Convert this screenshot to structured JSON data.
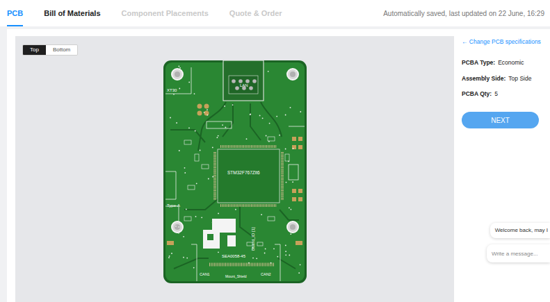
{
  "nav": {
    "tabs": [
      {
        "label": "PCB",
        "selected": true,
        "disabled": false
      },
      {
        "label": "Bill of Materials",
        "selected": false,
        "disabled": false
      },
      {
        "label": "Component Placements",
        "selected": false,
        "disabled": true
      },
      {
        "label": "Quote & Order",
        "selected": false,
        "disabled": true
      }
    ],
    "autosave": "Automatically saved, last updated on 22 June, 16:29"
  },
  "viewer": {
    "sides": [
      {
        "label": "Top",
        "selected": true
      },
      {
        "label": "Bottom",
        "selected": false
      }
    ],
    "board_labels": [
      "XT30",
      "LAN",
      "STM32F767Zit6",
      "Type-A",
      "Board_ID [1]",
      "SEA0058-45",
      "CAN1",
      "Mount_Shield",
      "CAN2"
    ]
  },
  "specs": {
    "back_link": "← Change PCB specifications",
    "fields": [
      {
        "label": "PCBA Type:",
        "value": "Economic"
      },
      {
        "label": "Assembly Side:",
        "value": "Top Side"
      },
      {
        "label": "PCBA Qty:",
        "value": "5"
      }
    ],
    "next_button": "NEXT"
  },
  "chat": {
    "greeting": "Welcome back, may I",
    "placeholder": "Write a message..."
  }
}
